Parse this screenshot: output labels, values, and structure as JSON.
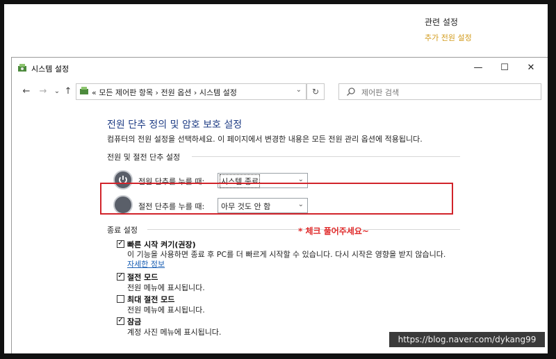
{
  "background": {
    "related_title": "관련 설정",
    "related_link": "추가 전원 설정"
  },
  "window": {
    "title": "시스템 설정",
    "controls": {
      "minimize": "—",
      "maximize": "☐",
      "close": "✕"
    }
  },
  "nav": {
    "back": "←",
    "forward": "→",
    "history": "⌄",
    "up": "↑",
    "address": "« 모든 제어판 항목 › 전원 옵션 › 시스템 설정",
    "address_chevron": "⌄",
    "refresh": "↻",
    "search_placeholder": "제어판 검색"
  },
  "page": {
    "heading": "전원 단추 정의 및 암호 보호 설정",
    "description": "컴퓨터의 전원 설정을 선택하세요. 이 페이지에서 변경한 내용은 모든 전원 관리 옵션에 적용됩니다.",
    "power_section": "전원 및 절전 단추 설정",
    "power_button_label": "전원 단추를 누를 때:",
    "power_button_value": "시스템 종료",
    "sleep_button_label": "절전 단추를 누를 때:",
    "sleep_button_value": "아무 것도 안 함",
    "shutdown_section": "종료 설정",
    "options": [
      {
        "label": "빠른 시작 켜기(권장)",
        "checked": true,
        "desc": "이 기능을 사용하면 종료 후 PC를 더 빠르게 시작할 수 있습니다. 다시 시작은 영향을 받지 않습니다.",
        "link": "자세한 정보"
      },
      {
        "label": "절전 모드",
        "checked": true,
        "desc": "전원 메뉴에 표시됩니다."
      },
      {
        "label": "최대 절전 모드",
        "checked": false,
        "desc": "전원 메뉴에 표시됩니다."
      },
      {
        "label": "잠금",
        "checked": true,
        "desc": "계정 사진 메뉴에 표시됩니다."
      }
    ]
  },
  "annotation": {
    "note": "* 체크 풀어주세요~"
  },
  "watermark": "https://blog.naver.com/dykang99",
  "colors": {
    "heading": "#1f3d85",
    "link": "#1a5fb4",
    "highlight": "#d1232a",
    "related_link": "#d29b1b"
  }
}
